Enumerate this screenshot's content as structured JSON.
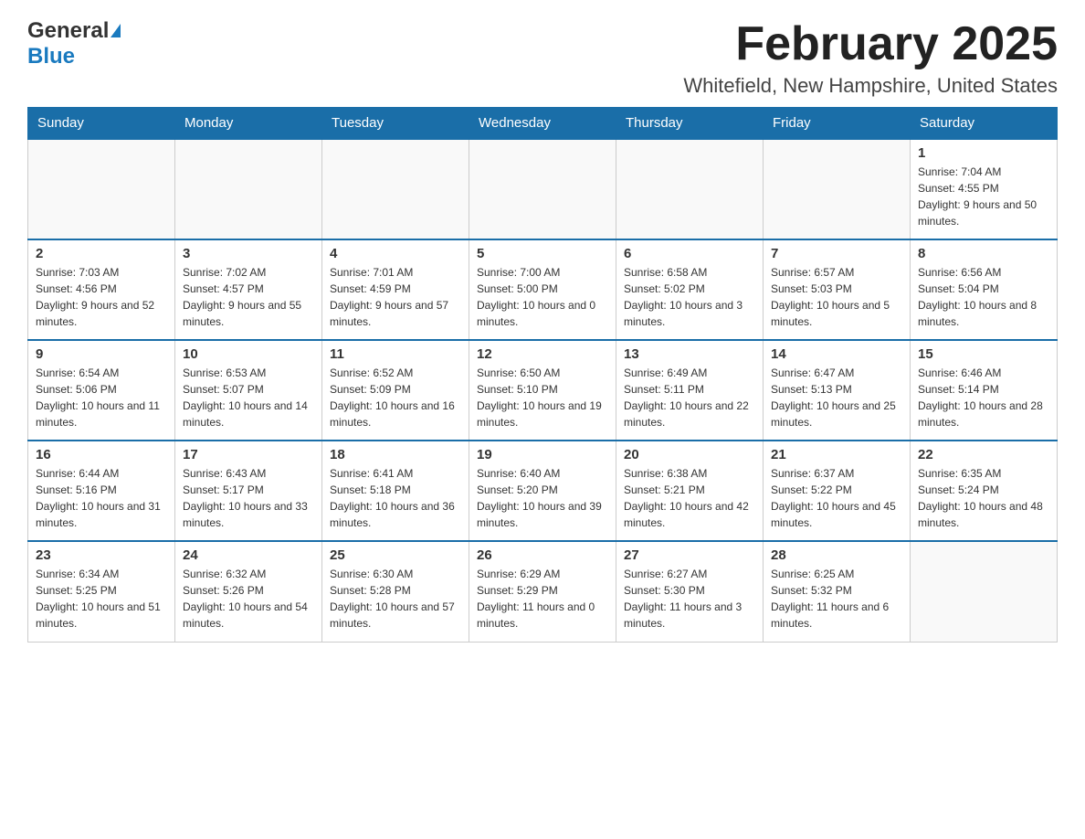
{
  "logo": {
    "general": "General",
    "triangle": "▶",
    "blue": "Blue"
  },
  "title": "February 2025",
  "location": "Whitefield, New Hampshire, United States",
  "days_of_week": [
    "Sunday",
    "Monday",
    "Tuesday",
    "Wednesday",
    "Thursday",
    "Friday",
    "Saturday"
  ],
  "weeks": [
    [
      {
        "day": "",
        "info": ""
      },
      {
        "day": "",
        "info": ""
      },
      {
        "day": "",
        "info": ""
      },
      {
        "day": "",
        "info": ""
      },
      {
        "day": "",
        "info": ""
      },
      {
        "day": "",
        "info": ""
      },
      {
        "day": "1",
        "info": "Sunrise: 7:04 AM\nSunset: 4:55 PM\nDaylight: 9 hours and 50 minutes."
      }
    ],
    [
      {
        "day": "2",
        "info": "Sunrise: 7:03 AM\nSunset: 4:56 PM\nDaylight: 9 hours and 52 minutes."
      },
      {
        "day": "3",
        "info": "Sunrise: 7:02 AM\nSunset: 4:57 PM\nDaylight: 9 hours and 55 minutes."
      },
      {
        "day": "4",
        "info": "Sunrise: 7:01 AM\nSunset: 4:59 PM\nDaylight: 9 hours and 57 minutes."
      },
      {
        "day": "5",
        "info": "Sunrise: 7:00 AM\nSunset: 5:00 PM\nDaylight: 10 hours and 0 minutes."
      },
      {
        "day": "6",
        "info": "Sunrise: 6:58 AM\nSunset: 5:02 PM\nDaylight: 10 hours and 3 minutes."
      },
      {
        "day": "7",
        "info": "Sunrise: 6:57 AM\nSunset: 5:03 PM\nDaylight: 10 hours and 5 minutes."
      },
      {
        "day": "8",
        "info": "Sunrise: 6:56 AM\nSunset: 5:04 PM\nDaylight: 10 hours and 8 minutes."
      }
    ],
    [
      {
        "day": "9",
        "info": "Sunrise: 6:54 AM\nSunset: 5:06 PM\nDaylight: 10 hours and 11 minutes."
      },
      {
        "day": "10",
        "info": "Sunrise: 6:53 AM\nSunset: 5:07 PM\nDaylight: 10 hours and 14 minutes."
      },
      {
        "day": "11",
        "info": "Sunrise: 6:52 AM\nSunset: 5:09 PM\nDaylight: 10 hours and 16 minutes."
      },
      {
        "day": "12",
        "info": "Sunrise: 6:50 AM\nSunset: 5:10 PM\nDaylight: 10 hours and 19 minutes."
      },
      {
        "day": "13",
        "info": "Sunrise: 6:49 AM\nSunset: 5:11 PM\nDaylight: 10 hours and 22 minutes."
      },
      {
        "day": "14",
        "info": "Sunrise: 6:47 AM\nSunset: 5:13 PM\nDaylight: 10 hours and 25 minutes."
      },
      {
        "day": "15",
        "info": "Sunrise: 6:46 AM\nSunset: 5:14 PM\nDaylight: 10 hours and 28 minutes."
      }
    ],
    [
      {
        "day": "16",
        "info": "Sunrise: 6:44 AM\nSunset: 5:16 PM\nDaylight: 10 hours and 31 minutes."
      },
      {
        "day": "17",
        "info": "Sunrise: 6:43 AM\nSunset: 5:17 PM\nDaylight: 10 hours and 33 minutes."
      },
      {
        "day": "18",
        "info": "Sunrise: 6:41 AM\nSunset: 5:18 PM\nDaylight: 10 hours and 36 minutes."
      },
      {
        "day": "19",
        "info": "Sunrise: 6:40 AM\nSunset: 5:20 PM\nDaylight: 10 hours and 39 minutes."
      },
      {
        "day": "20",
        "info": "Sunrise: 6:38 AM\nSunset: 5:21 PM\nDaylight: 10 hours and 42 minutes."
      },
      {
        "day": "21",
        "info": "Sunrise: 6:37 AM\nSunset: 5:22 PM\nDaylight: 10 hours and 45 minutes."
      },
      {
        "day": "22",
        "info": "Sunrise: 6:35 AM\nSunset: 5:24 PM\nDaylight: 10 hours and 48 minutes."
      }
    ],
    [
      {
        "day": "23",
        "info": "Sunrise: 6:34 AM\nSunset: 5:25 PM\nDaylight: 10 hours and 51 minutes."
      },
      {
        "day": "24",
        "info": "Sunrise: 6:32 AM\nSunset: 5:26 PM\nDaylight: 10 hours and 54 minutes."
      },
      {
        "day": "25",
        "info": "Sunrise: 6:30 AM\nSunset: 5:28 PM\nDaylight: 10 hours and 57 minutes."
      },
      {
        "day": "26",
        "info": "Sunrise: 6:29 AM\nSunset: 5:29 PM\nDaylight: 11 hours and 0 minutes."
      },
      {
        "day": "27",
        "info": "Sunrise: 6:27 AM\nSunset: 5:30 PM\nDaylight: 11 hours and 3 minutes."
      },
      {
        "day": "28",
        "info": "Sunrise: 6:25 AM\nSunset: 5:32 PM\nDaylight: 11 hours and 6 minutes."
      },
      {
        "day": "",
        "info": ""
      }
    ]
  ]
}
